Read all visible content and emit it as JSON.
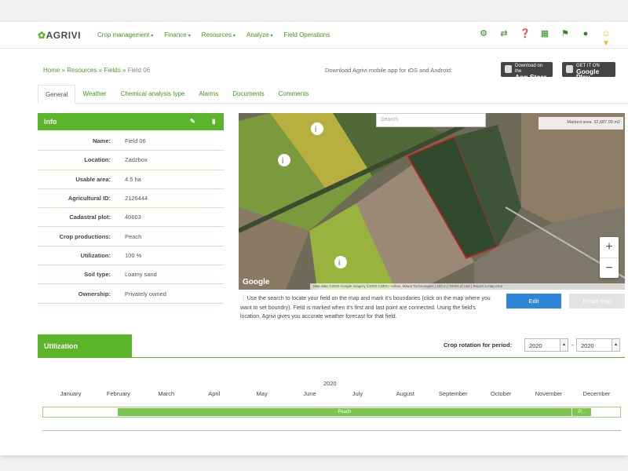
{
  "nav": {
    "logo": "AGRIVI",
    "menu": [
      "Crop management",
      "Finance",
      "Resources",
      "Analyze",
      "Field Operations"
    ],
    "menu_has_caret": [
      true,
      true,
      true,
      true,
      false
    ],
    "icons": [
      "gear-icon",
      "transfer-icon",
      "help-icon",
      "calendar-icon",
      "bell-icon",
      "chat-icon",
      "user-icon"
    ]
  },
  "breadcrumb": {
    "home": "Home",
    "resources": "Resources",
    "fields": "Fields",
    "current": "Field 06"
  },
  "download": {
    "text": "Download Agrivi mobile app for iOS and Android:",
    "appstore_small": "Download on the",
    "appstore": "App Store",
    "googleplay_small": "GET IT ON",
    "googleplay": "Google Play"
  },
  "tabs": [
    "General",
    "Weather",
    "Chemical analysis type",
    "Alarms",
    "Documents",
    "Comments"
  ],
  "info": {
    "title": "Info",
    "rows": [
      {
        "label": "Name:",
        "value": "Field 06"
      },
      {
        "label": "Location:",
        "value": "Zadzbox"
      },
      {
        "label": "Usable area:",
        "value": "4.5 ha"
      },
      {
        "label": "Agricultural ID:",
        "value": "2126444"
      },
      {
        "label": "Cadastral plot:",
        "value": "40603"
      },
      {
        "label": "Crop productions:",
        "value": "Peach"
      },
      {
        "label": "Utilization:",
        "value": "100 %"
      },
      {
        "label": "Soil type:",
        "value": "Loamy sand"
      },
      {
        "label": "Ownership:",
        "value": "Privately owned"
      }
    ]
  },
  "map": {
    "search_placeholder": "Search",
    "marked_area": "Marked area: 32,687.09 m2",
    "google": "Google",
    "attribution": "Map data ©2020 Google Imagery ©2020 CNES / Airbus, Maxar Technologies | 100 m | Terms of Use | Report a map error",
    "zoom_in": "+",
    "zoom_out": "−"
  },
  "hint": "Use the search to locate your field on the map and mark it's boundaries (click on the map where you want to set boundry). Field is marked when it's first and last point are connected. Using the field's location, Agrivi gives you accurate weather forecast for that field.",
  "buttons": {
    "edit": "Edit",
    "reset": "Reset map"
  },
  "utilization": {
    "title": "Utilization",
    "crop_rotation_label": "Crop rotation for period:",
    "from": "2020",
    "to": "2020",
    "dash": "-",
    "year": "2020",
    "months": [
      "January",
      "February",
      "March",
      "April",
      "May",
      "June",
      "July",
      "August",
      "September",
      "October",
      "November",
      "December"
    ],
    "bars": [
      {
        "label": "Peach",
        "start_month": 1.55,
        "end_month": 11.0
      },
      {
        "label": "P...",
        "start_month": 11.0,
        "end_month": 11.4
      }
    ]
  },
  "colors": {
    "accent": "#5ab52b",
    "link": "#3b9a1d",
    "edit_button": "#2f86d6"
  }
}
